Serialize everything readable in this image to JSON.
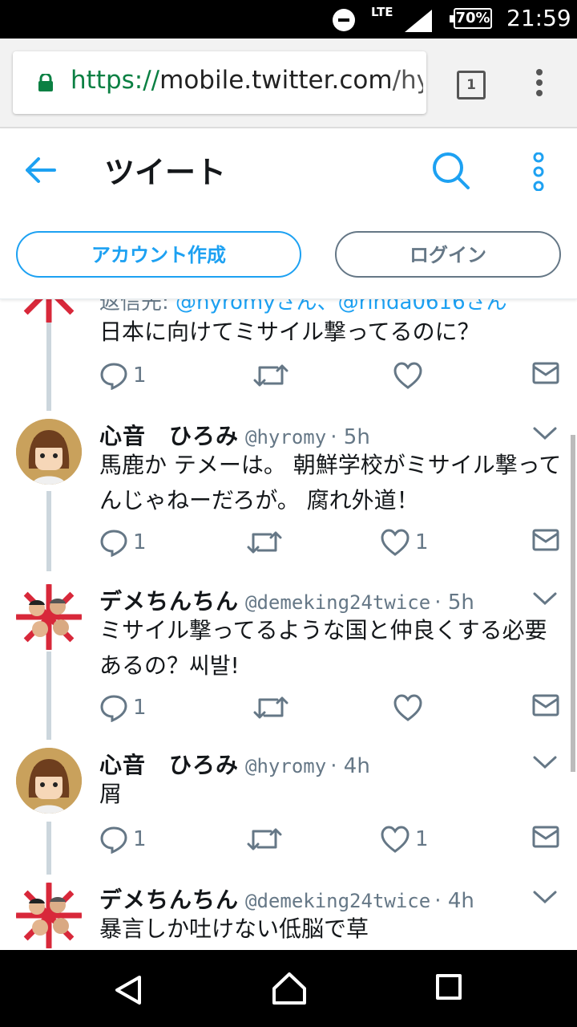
{
  "status_bar": {
    "network": "LTE",
    "battery": "70%",
    "time": "21:59"
  },
  "browser": {
    "url_scheme": "https://",
    "url_host": "mobile.twitter.com",
    "url_rest": "/hyromy/status",
    "tab_count": "1"
  },
  "header": {
    "title": "ツイート",
    "signup_label": "アカウント作成",
    "login_label": "ログイン"
  },
  "colors": {
    "accent": "#1da1f2",
    "secondary": "#657786"
  },
  "partial_tweet": {
    "reply_to_prefix": "返信先: ",
    "reply_to_handles": "@hyromyさん、@rinda0616さん",
    "text": "日本に向けてミサイル撃ってるのに？",
    "reply_count": "1",
    "retweet_count": "",
    "like_count": ""
  },
  "tweets": [
    {
      "name": "心音　ひろみ",
      "handle": "@hyromy",
      "time": "· 5h",
      "text": "馬鹿か テメーは。 朝鮮学校がミサイル撃ってんじゃねーだろが。 腐れ外道！",
      "reply_count": "1",
      "retweet_count": "",
      "like_count": "1"
    },
    {
      "name": "デメちんちん",
      "handle": "@demeking24twice",
      "time": "· 5h",
      "text": "ミサイル撃ってるような国と仲良くする必要あるの？씨발!",
      "reply_count": "1",
      "retweet_count": "",
      "like_count": ""
    },
    {
      "name": "心音　ひろみ",
      "handle": "@hyromy",
      "time": "· 4h",
      "text": "屑",
      "reply_count": "1",
      "retweet_count": "",
      "like_count": "1"
    },
    {
      "name": "デメちんちん",
      "handle": "@demeking24twice",
      "time": "· 4h",
      "text": "暴言しか吐けない低脳で草"
    }
  ]
}
